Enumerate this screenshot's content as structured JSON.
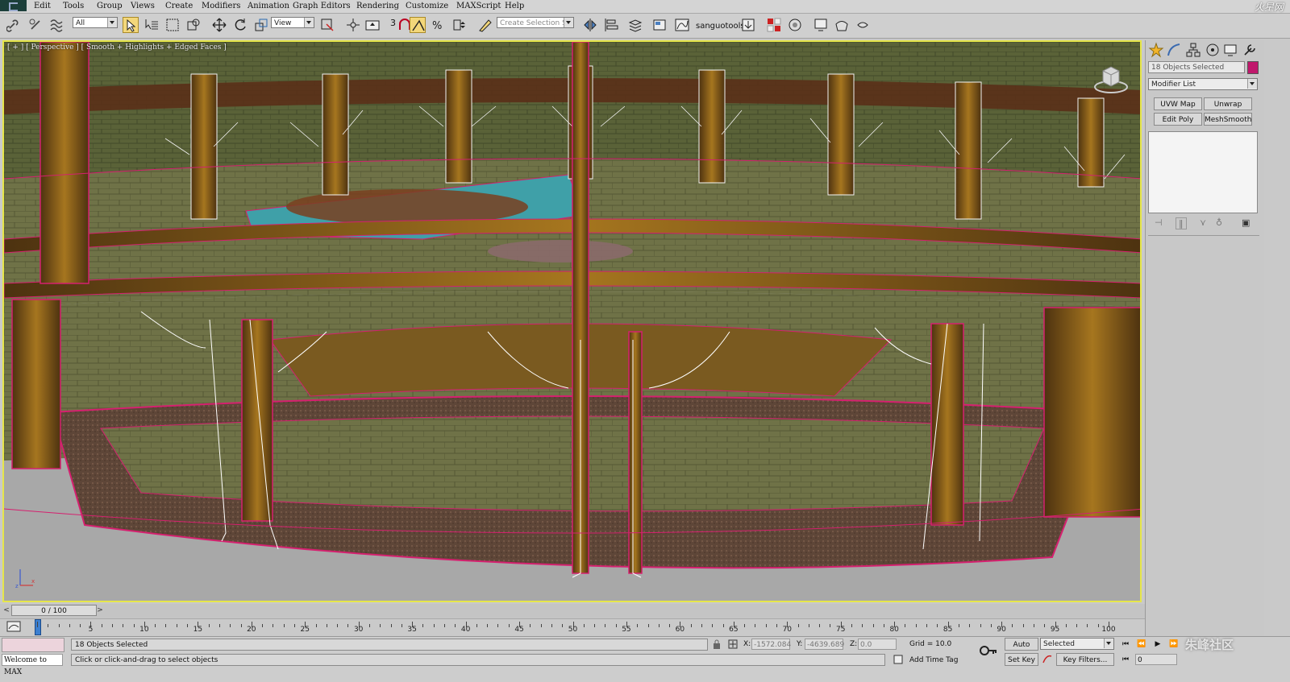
{
  "menubar": {
    "items": [
      "Edit",
      "Tools",
      "Group",
      "Views",
      "Create",
      "Modifiers",
      "Animation",
      "Graph Editors",
      "Rendering",
      "Customize",
      "MAXScript",
      "Help"
    ],
    "brand_text": "火星网"
  },
  "toolbar": {
    "selection_filter": "All",
    "ref_coord": "View",
    "named_selection_placeholder": "Create Selection Se",
    "snap_value": "3",
    "custom_label": "sanguotools"
  },
  "viewport": {
    "label": "[ + ] [ Perspective ] [ Smooth + Highlights + Edged Faces ]",
    "colors": {
      "border": "#e6e64a",
      "wire": "#d5206f",
      "floor": "#6b6e45",
      "ground": "#a8a8a8"
    }
  },
  "command_panel": {
    "selection_count": "18 Objects Selected",
    "modifier_list": "Modifier List",
    "buttons": [
      "UVW Map",
      "Unwrap UVW",
      "Edit Poly",
      "MeshSmooth"
    ],
    "object_color": "#c0186c"
  },
  "timeline": {
    "frame_display": "0 / 100",
    "prev_label": "<",
    "next_label": ">",
    "ticks": [
      "5",
      "10",
      "15",
      "20",
      "25",
      "30",
      "35",
      "40",
      "45",
      "50",
      "55",
      "60",
      "65",
      "70",
      "75",
      "80",
      "85",
      "90",
      "95",
      "100"
    ]
  },
  "status": {
    "selection_info": "18 Objects Selected",
    "prompt": "Click or click-and-drag to select objects",
    "welcome": "Welcome to MAX",
    "x_label": "X:",
    "x_value": "-1572.084",
    "y_label": "Y:",
    "y_value": "-4639.689",
    "z_label": "Z:",
    "z_value": "0.0",
    "grid": "Grid = 10.0",
    "add_time_tag": "Add Time Tag",
    "auto_key": "Auto Key",
    "set_key": "Set Key",
    "key_mode": "Selected",
    "key_filters": "Key Filters...",
    "frame_field": "0",
    "watermark": "朱峰社区"
  }
}
